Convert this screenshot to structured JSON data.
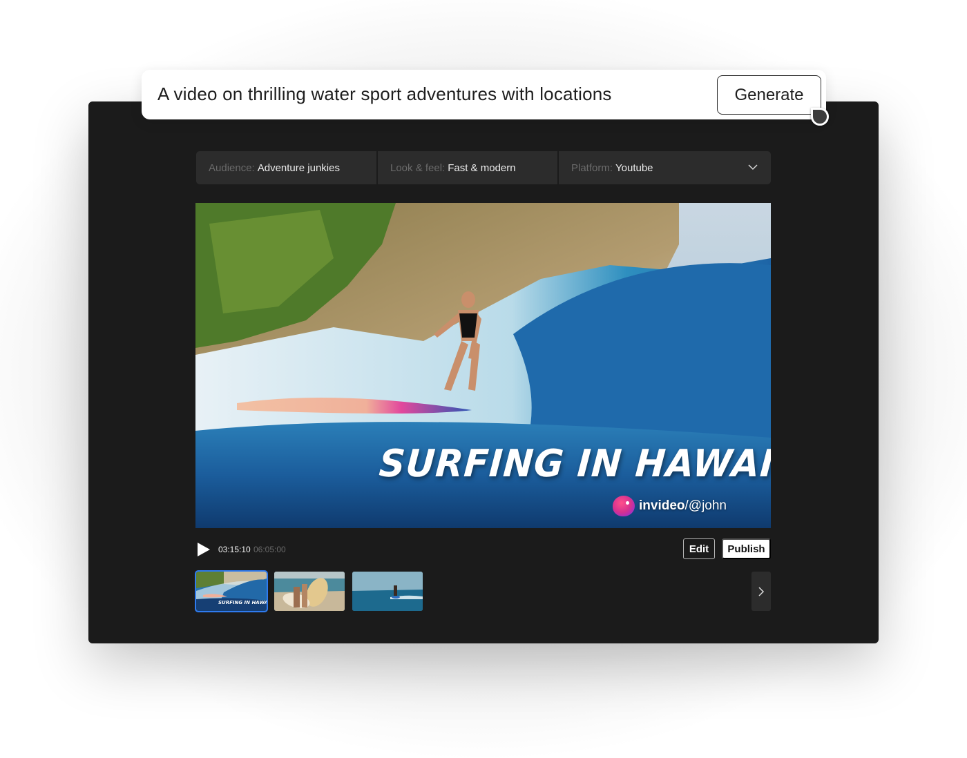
{
  "prompt": {
    "text": "A video on thrilling water sport adventures with locations",
    "generate_label": "Generate"
  },
  "filters": [
    {
      "label": "Audience:",
      "value": "Adventure junkies"
    },
    {
      "label": "Look & feel:",
      "value": "Fast & modern"
    },
    {
      "label": "Platform:",
      "value": "Youtube",
      "icon": "chevron-down-icon"
    }
  ],
  "video": {
    "title_overlay": "SURFING IN HAWAII",
    "watermark_brand": "invideo",
    "watermark_handle": "/@john",
    "scene": "surfer riding a blue wave near a green cliff"
  },
  "controls": {
    "play_icon": "play-icon",
    "time_current": "03:15:10",
    "time_total": "06:05:00",
    "edit_label": "Edit",
    "publish_label": "Publish"
  },
  "thumbnails": [
    {
      "caption": "SURFING IN HAWAII",
      "selected": true,
      "scene": "surfer on wave"
    },
    {
      "caption": "",
      "selected": false,
      "scene": "two people carrying surfboards"
    },
    {
      "caption": "",
      "selected": false,
      "scene": "surfer on calm open sea"
    }
  ],
  "thumbnails_next_icon": "chevron-right-icon",
  "colors": {
    "panel_bg": "#1b1b1b",
    "filter_bg": "#2c2c2c",
    "selected_thumb_border": "#2f7bf0",
    "filter_label": "#6b6b6b"
  }
}
